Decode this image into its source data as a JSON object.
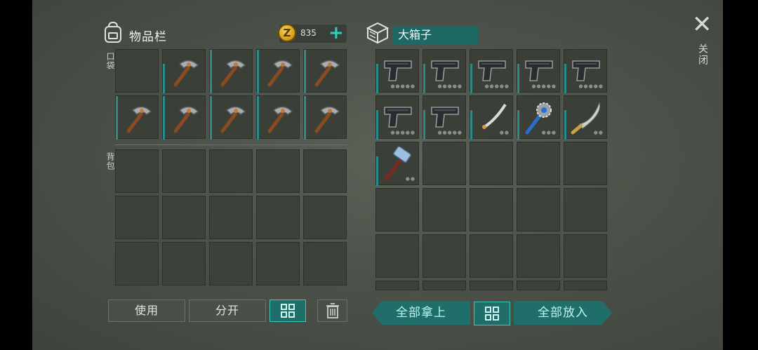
{
  "inventory": {
    "title": "物品栏",
    "icon": "backpack-icon",
    "coins": "835",
    "coin_symbol": "Z",
    "add_label": "+",
    "pocket_label": "口袋",
    "backpack_label": "背包",
    "pocket_slots": [
      "empty",
      "pickaxe",
      "pickaxe",
      "pickaxe",
      "pickaxe",
      "pickaxe",
      "pickaxe",
      "pickaxe",
      "pickaxe",
      "pickaxe"
    ],
    "backpack_slots": [
      "empty",
      "empty",
      "empty",
      "empty",
      "empty",
      "empty",
      "empty",
      "empty",
      "empty",
      "empty",
      "empty",
      "empty",
      "empty",
      "empty",
      "empty"
    ]
  },
  "chest": {
    "title": "大箱子",
    "icon": "box-icon",
    "slots": [
      "pistol",
      "pistol",
      "pistol",
      "pistol",
      "pistol",
      "pistol",
      "pistol",
      "katana",
      "mace",
      "machete",
      "hammer",
      "empty",
      "empty",
      "empty",
      "empty",
      "empty",
      "empty",
      "empty",
      "empty",
      "empty",
      "empty",
      "empty",
      "empty",
      "empty",
      "empty",
      "empty",
      "empty",
      "empty",
      "empty",
      "empty"
    ]
  },
  "buttons": {
    "use": "使用",
    "split": "分开",
    "take_all": "全部拿上",
    "put_all": "全部放入"
  },
  "close": {
    "label": "关闭",
    "symbol": "✕"
  },
  "colors": {
    "accent": "#2fd0b8",
    "button_teal": "#1f6e6a",
    "background": "#4c5249"
  }
}
